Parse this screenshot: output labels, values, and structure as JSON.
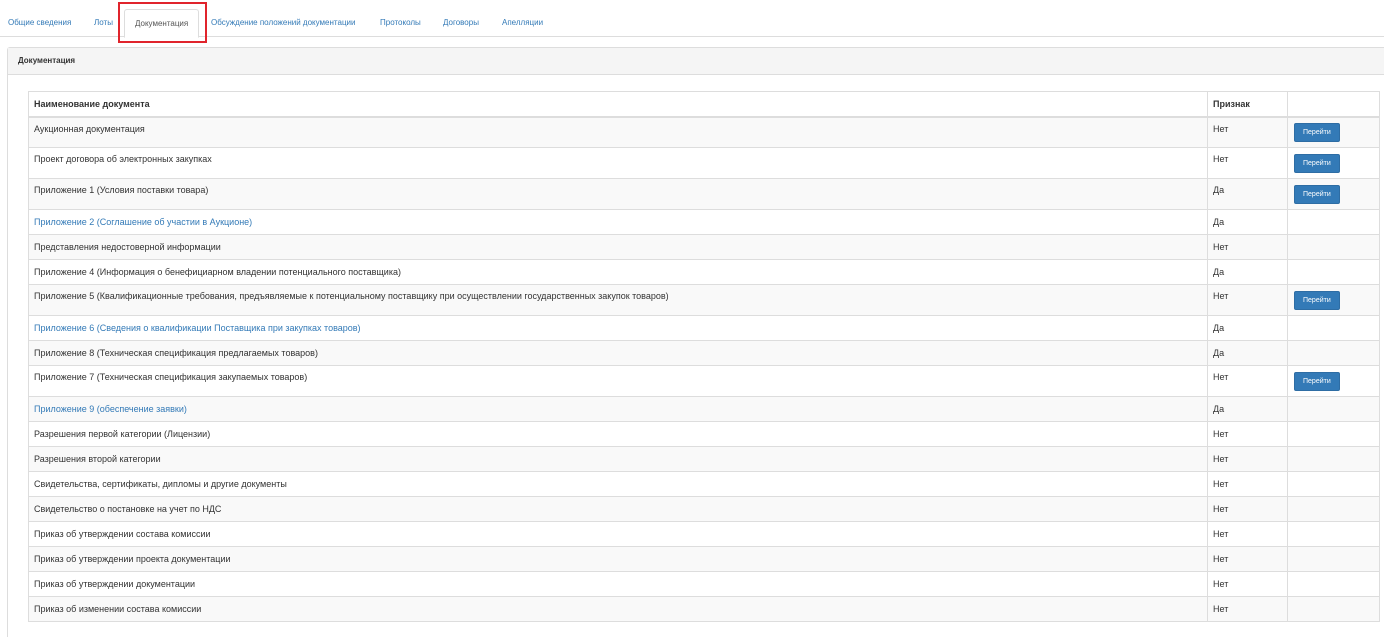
{
  "tabs": [
    {
      "label": "Общие сведения"
    },
    {
      "label": "Лоты"
    },
    {
      "label": "Документация",
      "active": true
    },
    {
      "label": "Обсуждение положений документации"
    },
    {
      "label": "Протоколы"
    },
    {
      "label": "Договоры"
    },
    {
      "label": "Апелляции"
    }
  ],
  "panel": {
    "title": "Документация"
  },
  "table": {
    "headers": {
      "name": "Наименование документа",
      "flag": "Признак",
      "action": ""
    },
    "button_label": "Перейти",
    "rows": [
      {
        "name": "Аукционная документация",
        "flag": "Нет",
        "button": true,
        "link": false
      },
      {
        "name": "Проект договора об электронных закупках",
        "flag": "Нет",
        "button": true,
        "link": false
      },
      {
        "name": "Приложение 1 (Условия поставки товара)",
        "flag": "Да",
        "button": true,
        "link": false
      },
      {
        "name": "Приложение 2 (Соглашение об участии в Аукционе)",
        "flag": "Да",
        "button": false,
        "link": true
      },
      {
        "name": "Представления недостоверной информации",
        "flag": "Нет",
        "button": false,
        "link": false
      },
      {
        "name": "Приложение 4 (Информация о бенефициарном владении потенциального поставщика)",
        "flag": "Да",
        "button": false,
        "link": false
      },
      {
        "name": "Приложение 5 (Квалификационные требования, предъявляемые к потенциальному поставщику при осуществлении государственных закупок товаров)",
        "flag": "Нет",
        "button": true,
        "link": false
      },
      {
        "name": "Приложение 6 (Сведения о квалификации Поставщика при закупках товаров)",
        "flag": "Да",
        "button": false,
        "link": true
      },
      {
        "name": "Приложение 8 (Техническая спецификация предлагаемых товаров)",
        "flag": "Да",
        "button": false,
        "link": false
      },
      {
        "name": "Приложение 7 (Техническая спецификация закупаемых товаров)",
        "flag": "Нет",
        "button": true,
        "link": false
      },
      {
        "name": "Приложение 9 (обеспечение заявки)",
        "flag": "Да",
        "button": false,
        "link": true
      },
      {
        "name": "Разрешения первой категории (Лицензии)",
        "flag": "Нет",
        "button": false,
        "link": false
      },
      {
        "name": "Разрешения второй категории",
        "flag": "Нет",
        "button": false,
        "link": false
      },
      {
        "name": "Свидетельства, сертификаты, дипломы и другие документы",
        "flag": "Нет",
        "button": false,
        "link": false
      },
      {
        "name": "Свидетельство о постановке на учет по НДС",
        "flag": "Нет",
        "button": false,
        "link": false
      },
      {
        "name": "Приказ об утверждении состава комиссии",
        "flag": "Нет",
        "button": false,
        "link": false
      },
      {
        "name": "Приказ об утверждении проекта документации",
        "flag": "Нет",
        "button": false,
        "link": false
      },
      {
        "name": "Приказ об утверждении документации",
        "flag": "Нет",
        "button": false,
        "link": false
      },
      {
        "name": "Приказ об изменении состава комиссии",
        "flag": "Нет",
        "button": false,
        "link": false
      }
    ]
  },
  "colors": {
    "link": "#337ab7",
    "button": "#337ab7",
    "highlight": "#e0242c"
  }
}
